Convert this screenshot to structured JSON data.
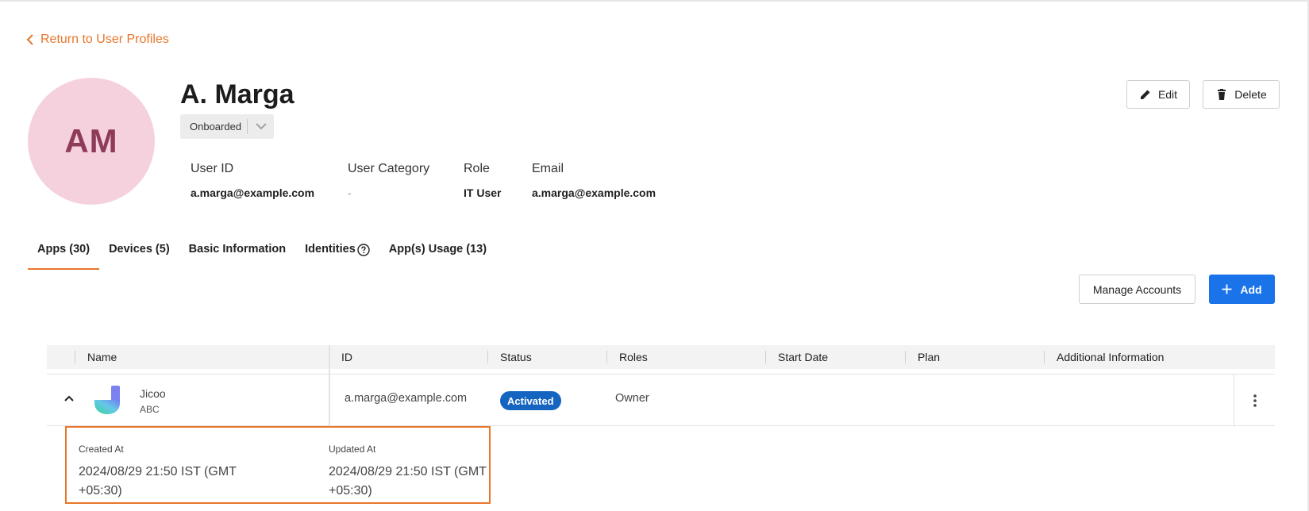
{
  "nav": {
    "back_label": "Return to User Profiles"
  },
  "profile": {
    "initials": "AM",
    "name": "A. Marga",
    "status": "Onboarded",
    "fields": {
      "user_id": {
        "label": "User ID",
        "value": "a.marga@example.com"
      },
      "category": {
        "label": "User Category",
        "value": "-"
      },
      "role": {
        "label": "Role",
        "value": "IT User"
      },
      "email": {
        "label": "Email",
        "value": "a.marga@example.com"
      }
    }
  },
  "actions": {
    "edit": "Edit",
    "delete": "Delete",
    "manage_accounts": "Manage Accounts",
    "add": "Add"
  },
  "tabs": [
    {
      "label": "Apps (30)"
    },
    {
      "label": "Devices (5)"
    },
    {
      "label": "Basic Information"
    },
    {
      "label": "Identities"
    },
    {
      "label": "App(s) Usage (13)"
    }
  ],
  "table": {
    "columns": [
      "Name",
      "ID",
      "Status",
      "Roles",
      "Start Date",
      "Plan",
      "Additional Information"
    ],
    "rows": [
      {
        "name": "Jicoo",
        "sub": "ABC",
        "id": "a.marga@example.com",
        "status": "Activated",
        "roles": "Owner"
      }
    ]
  },
  "details": {
    "created_label": "Created At",
    "created_value": "2024/08/29 21:50 IST (GMT +05:30)",
    "updated_label": "Updated At",
    "updated_value": "2024/08/29 21:50 IST (GMT +05:30)"
  },
  "colors": {
    "accent": "#e8762b",
    "primary": "#1a73e8",
    "badge": "#1565c0",
    "avatar_bg": "#f5d1dd"
  },
  "icons": [
    "chevron-left-icon",
    "chevron-down-icon",
    "pencil-icon",
    "trash-icon",
    "help-circle-icon",
    "plus-icon",
    "chevron-up-icon",
    "jicoo-logo-icon",
    "kebab-menu-icon"
  ]
}
